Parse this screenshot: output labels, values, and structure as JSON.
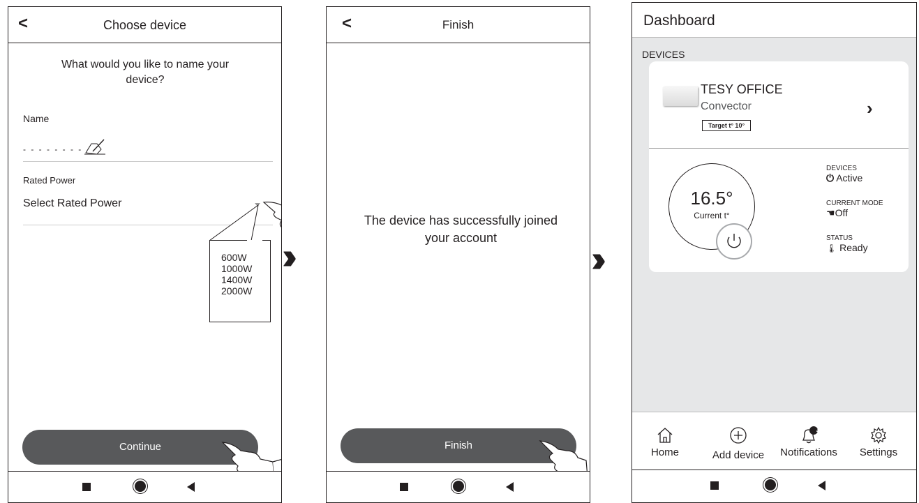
{
  "screen1": {
    "title": "Choose device",
    "question": "What would you like to name your device?",
    "name_label": "Name",
    "power_label": "Rated Power",
    "power_value": "Select Rated Power",
    "callout_options": [
      "600W",
      "1000W",
      "1400W",
      "2000W"
    ],
    "continue_label": "Continue"
  },
  "screen2": {
    "title": "Finish",
    "message": "The device has successfully joined your account",
    "finish_label": "Finish"
  },
  "screen3": {
    "title": "Dashboard",
    "section": "DEVICES",
    "device_name": "TESY OFFICE",
    "device_type": "Convector",
    "target_badge": "Target t° 10°",
    "temperature": "16.5°",
    "temp_caption": "Current t°",
    "status_items": [
      {
        "label": "DEVICES",
        "value": "Active",
        "icon": "power-icon"
      },
      {
        "label": "CURRENT MODE",
        "value": "Off",
        "icon": "hand-icon"
      },
      {
        "label": "STATUS",
        "value": "Ready",
        "icon": "thermometer-icon"
      }
    ],
    "tabs": [
      {
        "label": "Home",
        "icon": "home-icon"
      },
      {
        "label": "Add device",
        "icon": "add-icon"
      },
      {
        "label": "Notifications",
        "icon": "bell-icon",
        "badge": "4"
      },
      {
        "label": "Settings",
        "icon": "gear-icon"
      }
    ]
  },
  "colors": {
    "dark": "#231f20",
    "button": "#58595b",
    "panel": "#e6e7e8"
  }
}
